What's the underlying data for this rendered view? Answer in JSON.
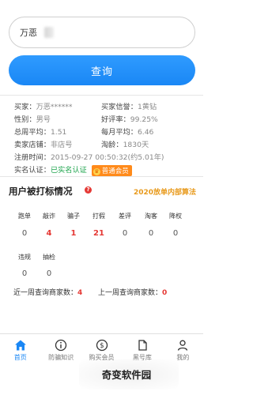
{
  "search": {
    "value": "万恶",
    "placeholder": ""
  },
  "query_button": "查询",
  "buyer": {
    "name_label": "买家：",
    "name_value": "万恶******",
    "credit_label": "买家信誉：",
    "credit_value": "1黄钻",
    "gender_label": "性别：",
    "gender_value": "男号",
    "rating_label": "好评率：",
    "rating_value": "99.25%",
    "weekly_label": "总周平均：",
    "weekly_value": "1.51",
    "monthly_label": "每月平均：",
    "monthly_value": "6.46",
    "shop_label": "卖家店铺：",
    "shop_value": "非店号",
    "age_label": "淘龄：",
    "age_value": "1830天",
    "reg_label": "注册时间：",
    "reg_value": "2015-09-27 00:50:32(约5.01年)",
    "verify_label": "实名认证：",
    "verify_value": "已实名认证",
    "vip_value": "普通会员"
  },
  "section": {
    "title": "用户被打标情况",
    "algo_link": "2020放单内部算法"
  },
  "tags_row1": [
    {
      "label": "跑单",
      "value": "0",
      "red": false
    },
    {
      "label": "敲诈",
      "value": "4",
      "red": true
    },
    {
      "label": "骗子",
      "value": "1",
      "red": true
    },
    {
      "label": "打假",
      "value": "21",
      "red": true
    },
    {
      "label": "差评",
      "value": "0",
      "red": false
    },
    {
      "label": "淘客",
      "value": "0",
      "red": false
    },
    {
      "label": "降权",
      "value": "0",
      "red": false
    }
  ],
  "tags_row2": [
    {
      "label": "违规",
      "value": "0",
      "red": false
    },
    {
      "label": "抽检",
      "value": "0",
      "red": false
    }
  ],
  "week_stats": {
    "recent_label": "近一周查询商家数：",
    "recent_value": "4",
    "last_label": "上一周查询商家数：",
    "last_value": "0"
  },
  "tabs": [
    {
      "label": "首页",
      "icon": "home-icon",
      "active": true
    },
    {
      "label": "防骗知识",
      "icon": "info-icon",
      "active": false
    },
    {
      "label": "购买会员",
      "icon": "coin-icon",
      "active": false
    },
    {
      "label": "黑号库",
      "icon": "document-icon",
      "active": false
    },
    {
      "label": "我的",
      "icon": "user-icon",
      "active": false
    }
  ],
  "watermark": "奇变软件园",
  "colors": {
    "accent": "#1a87f5",
    "danger": "#e53935",
    "vip": "#ff8a1a",
    "link": "#e89a1c",
    "verified": "#1aa34a"
  }
}
